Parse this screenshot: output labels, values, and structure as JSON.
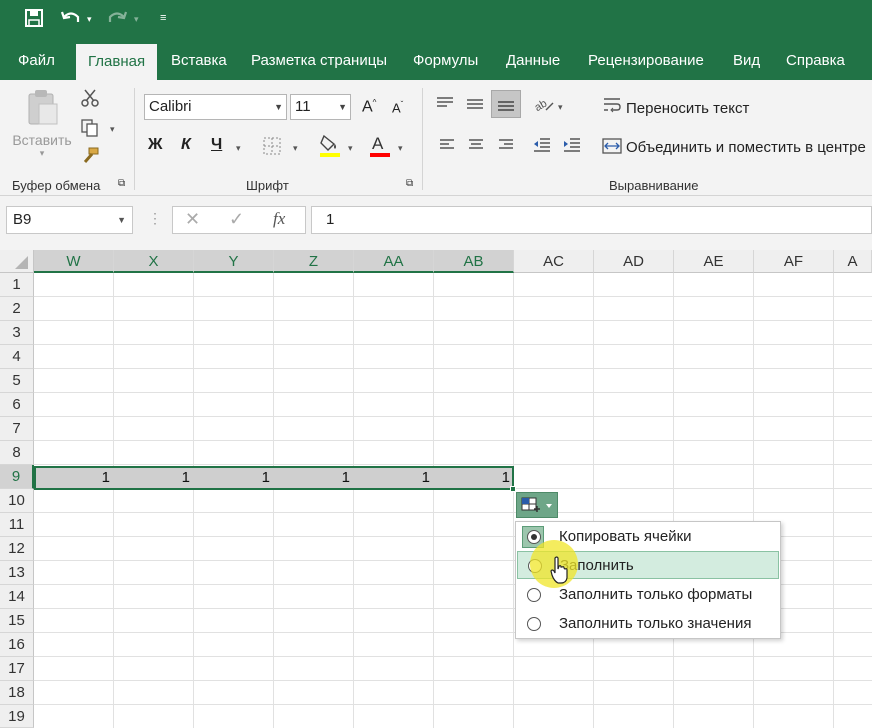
{
  "app": {
    "quick_access": {
      "save_icon": "save-icon",
      "undo_icon": "undo-icon",
      "redo_icon": "redo-icon"
    },
    "tabs": [
      {
        "label": "Файл",
        "active": false
      },
      {
        "label": "Главная",
        "active": true
      },
      {
        "label": "Вставка",
        "active": false
      },
      {
        "label": "Разметка страницы",
        "active": false
      },
      {
        "label": "Формулы",
        "active": false
      },
      {
        "label": "Данные",
        "active": false
      },
      {
        "label": "Рецензирование",
        "active": false
      },
      {
        "label": "Вид",
        "active": false
      },
      {
        "label": "Справка",
        "active": false
      }
    ],
    "accent_color": "#217346"
  },
  "ribbon": {
    "clipboard": {
      "paste_label": "Вставить",
      "group_label": "Буфер обмена"
    },
    "font": {
      "font_name": "Calibri",
      "font_size": "11",
      "bold": "Ж",
      "italic": "К",
      "underline": "Ч",
      "group_label": "Шрифт",
      "fill_color": "#ffff00",
      "font_color": "#ff0000"
    },
    "alignment": {
      "wrap_text": "Переносить текст",
      "merge_center": "Объединить и поместить в центре",
      "group_label": "Выравнивание"
    }
  },
  "formula_bar": {
    "name_box": "B9",
    "fx": "fx",
    "value": "1"
  },
  "sheet": {
    "columns": [
      "W",
      "X",
      "Y",
      "Z",
      "AA",
      "AB",
      "AC",
      "AD",
      "AE",
      "AF",
      "A"
    ],
    "selected_columns": [
      "W",
      "X",
      "Y",
      "Z",
      "AA",
      "AB"
    ],
    "rows": [
      "1",
      "2",
      "3",
      "4",
      "5",
      "6",
      "7",
      "8",
      "9",
      "10",
      "11",
      "12",
      "13",
      "14",
      "15",
      "16",
      "17",
      "18",
      "19"
    ],
    "selected_row": "9",
    "row9_values": [
      "1",
      "1",
      "1",
      "1",
      "1",
      "1"
    ]
  },
  "autofill_menu": {
    "items": [
      {
        "label": "Копировать ячейки",
        "checked": true
      },
      {
        "label": "Заполнить",
        "checked": false,
        "hover": true
      },
      {
        "label": "Заполнить только форматы",
        "checked": false
      },
      {
        "label": "Заполнить только значения",
        "checked": false
      }
    ]
  }
}
